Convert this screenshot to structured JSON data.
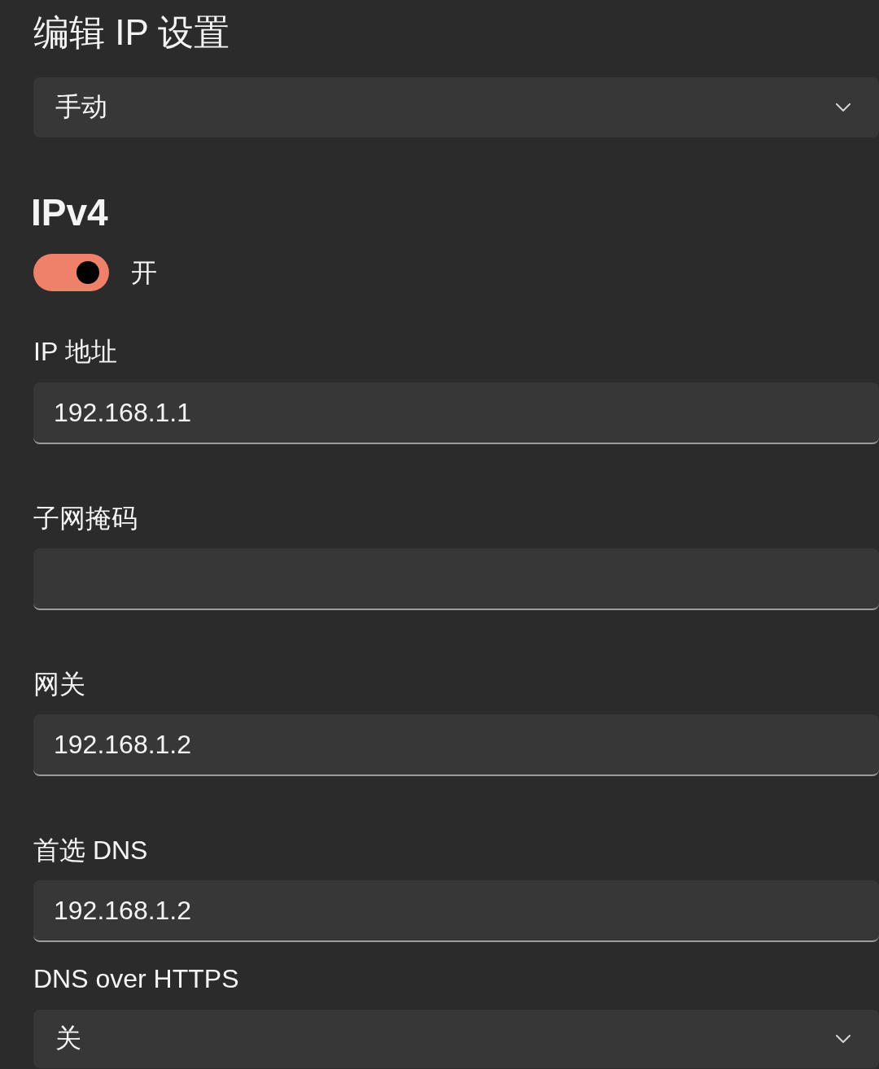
{
  "title": "编辑 IP 设置",
  "mode_select": {
    "value": "手动"
  },
  "ipv4": {
    "heading": "IPv4",
    "toggle": {
      "on": true,
      "label": "开"
    },
    "fields": [
      {
        "kind": "text",
        "label": "IP 地址",
        "value": "192.168.1.1"
      },
      {
        "kind": "text",
        "label": "子网掩码"
      },
      {
        "kind": "text",
        "label": "网关",
        "value": "192.168.1.2"
      },
      {
        "kind": "text",
        "label": "首选 DNS",
        "value": "192.168.1.2"
      },
      {
        "kind": "select",
        "label": "DNS over HTTPS",
        "value": "关"
      }
    ]
  }
}
